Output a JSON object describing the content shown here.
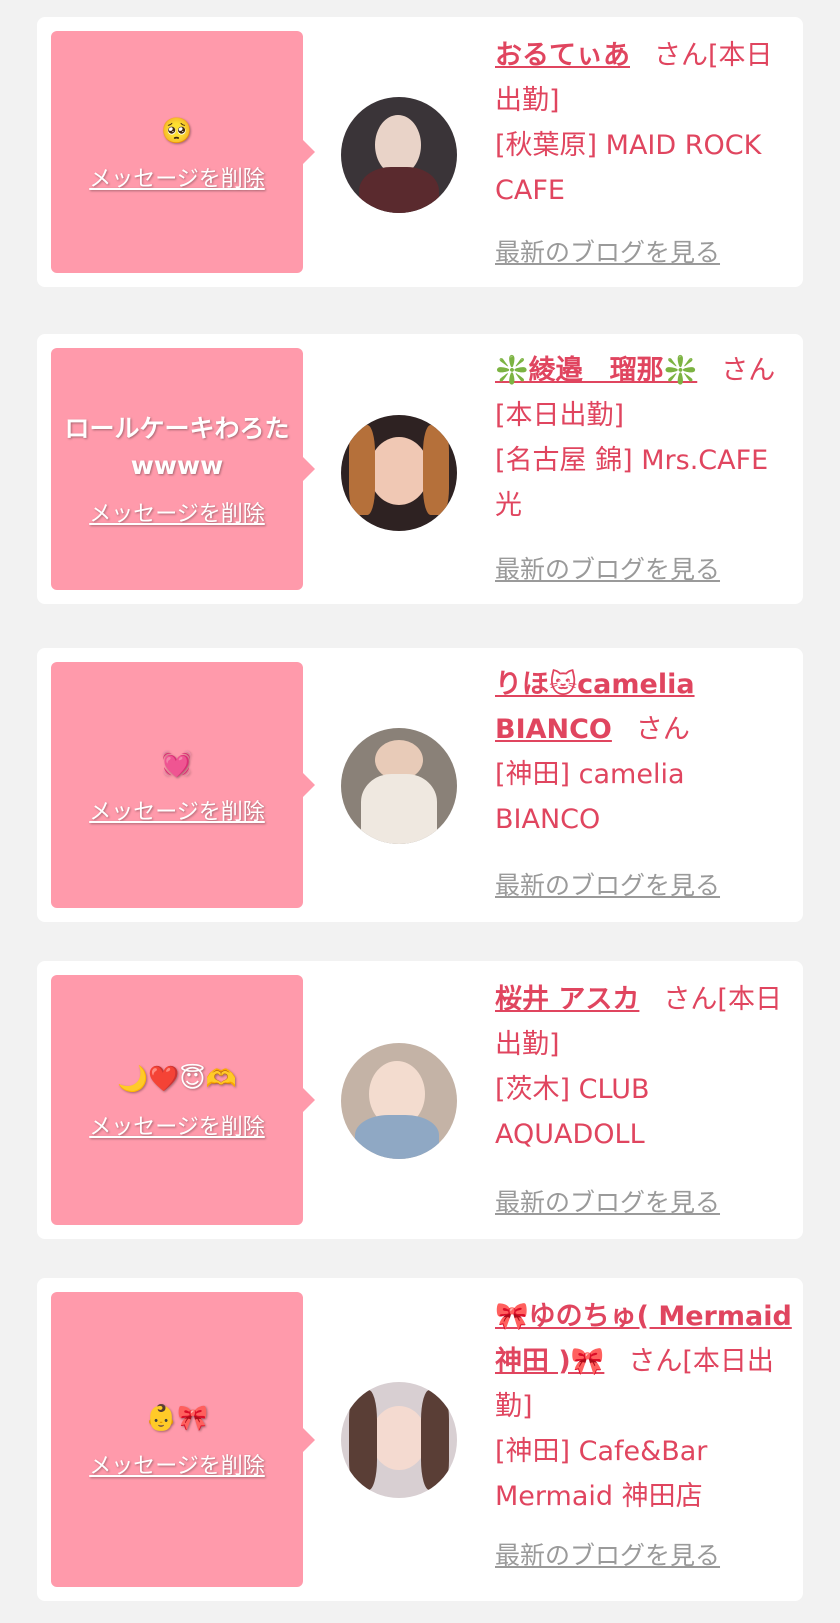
{
  "delete_label": "メッセージを削除",
  "blog_label": "最新のブログを見る",
  "colors": {
    "bubble": "#ff9aab",
    "name": "#e0455f",
    "blog_link": "#9a9a9a",
    "background": "#f2f2f2"
  },
  "items": [
    {
      "message": "🥺",
      "name": "おるてぃあ",
      "suffix": "さん[本日出勤]",
      "shop": "[秋葉原] MAID ROCK CAFE"
    },
    {
      "message": "ロールケーキわろたwwww",
      "name": "❇️綾邉　瑠那❇️",
      "suffix": "さん[本日出勤]",
      "shop": "[名古屋 錦] Mrs.CAFE 光"
    },
    {
      "message": "💓",
      "name": "りほ🐱camelia BIANCO",
      "suffix": "さん",
      "shop": "[神田] camelia BIANCO"
    },
    {
      "message": "🌙❤️😇🫶",
      "name": "桜井 アスカ",
      "suffix": "さん[本日出勤]",
      "shop": "[茨木] CLUB AQUADOLL"
    },
    {
      "message": "👶🎀",
      "name": "🎀ゆのちゅ( Mermaid神田 )🎀",
      "suffix": "さん[本日出勤]",
      "shop": "[神田] Cafe&Bar Mermaid 神田店"
    }
  ]
}
